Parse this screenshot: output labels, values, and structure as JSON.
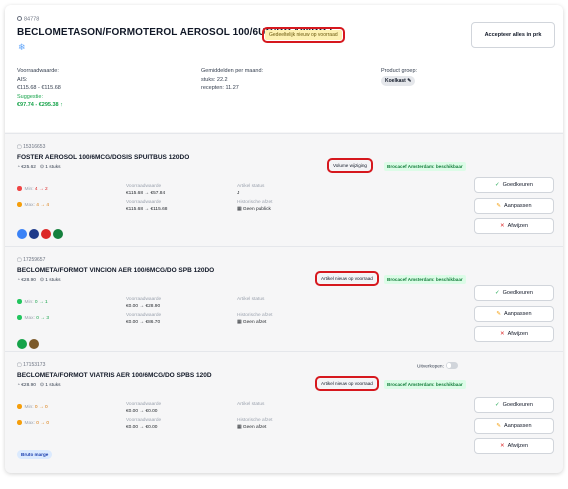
{
  "header": {
    "product_id": "84778",
    "title": "BECLOMETASON/FORMOTEROL AEROSOL 100/6UG/DO 120DO I",
    "status_badge": "Gedeeltelijk nieuw op voorraad",
    "accept_all_label": "Accepteer alles in prk"
  },
  "summary": {
    "stock_label": "Voorraadwaarde:",
    "ais_label": "AIS:",
    "ais_range": "€115.68 - €115.68",
    "suggestion_label": "Suggestie:",
    "suggestion_range": "€97.74 - €295.38 ↑",
    "avg_label": "Gemiddelden per maand:",
    "avg_units": "stuks: 22.2",
    "avg_recipes": "recepten: 11.27",
    "group_label": "Product groep:",
    "group_value": "Koelkast"
  },
  "products": [
    {
      "id": "15316653",
      "name": "FOSTER AEROSOL 100/6MCG/DOSIS SPUITBUS 120DO",
      "price": "€25.62",
      "qty": "1 stuks",
      "status_box": "Volume wijziging",
      "supplier": "Brocacef Amsterdam: beschikbaar",
      "min_label": "Min:",
      "min_value": "4 → 2",
      "max_label": "Max:",
      "max_value": "4 → 4",
      "stock1_label": "Voorraadwaarde",
      "stock1_value": "€115.68 → €57.84",
      "stock2_label": "Voorraadwaarde",
      "stock2_value": "€115.68 → €115.68",
      "article_label": "Artikel status",
      "article_value": "J",
      "hist_label": "Historische afzet",
      "hist_value": "Geen publick"
    },
    {
      "id": "17259657",
      "name": "BECLOMETA/FORMOT VINCION AER 100/6MCG/DO SPB 120DO",
      "price": "€28.90",
      "qty": "1 stuks",
      "status_box": "Artikel nieuw op voorraad",
      "supplier": "Brocacef Amsterdam: beschikbaar",
      "min_label": "Min:",
      "min_value": "0 → 1",
      "max_label": "Max:",
      "max_value": "0 → 3",
      "stock1_label": "Voorraadwaarde",
      "stock1_value": "€0.00 → €28.90",
      "stock2_label": "Voorraadwaarde",
      "stock2_value": "€0.00 → €86.70",
      "article_label": "Artikel status",
      "article_value": "",
      "hist_label": "Historische afzet",
      "hist_value": "Geen afzet"
    },
    {
      "id": "17153173",
      "name": "BECLOMETA/FORMOT VIATRIS AER 100/6MCG/DO SPBS 120D",
      "price": "€28.90",
      "qty": "1 stuks",
      "status_box": "Artikel nieuw op voorraad",
      "supplier": "Brocacef Amsterdam: beschikbaar",
      "min_label": "Min:",
      "min_value": "0 → 0",
      "max_label": "Max:",
      "max_value": "0 → 0",
      "stock1_label": "Voorraadwaarde",
      "stock1_value": "€0.00 → €0.00",
      "stock2_label": "Voorraadwaarde",
      "stock2_value": "€0.00 → €0.00",
      "article_label": "Artikel status",
      "article_value": "",
      "hist_label": "Historische afzet",
      "hist_value": "Geen afzet",
      "sellout_label": "Uitverkopen:",
      "extra_pill": "Bruto marge"
    }
  ],
  "actions": {
    "approve": "Goedkeuren",
    "adjust": "Aanpassen",
    "reject": "Afwijzen"
  }
}
